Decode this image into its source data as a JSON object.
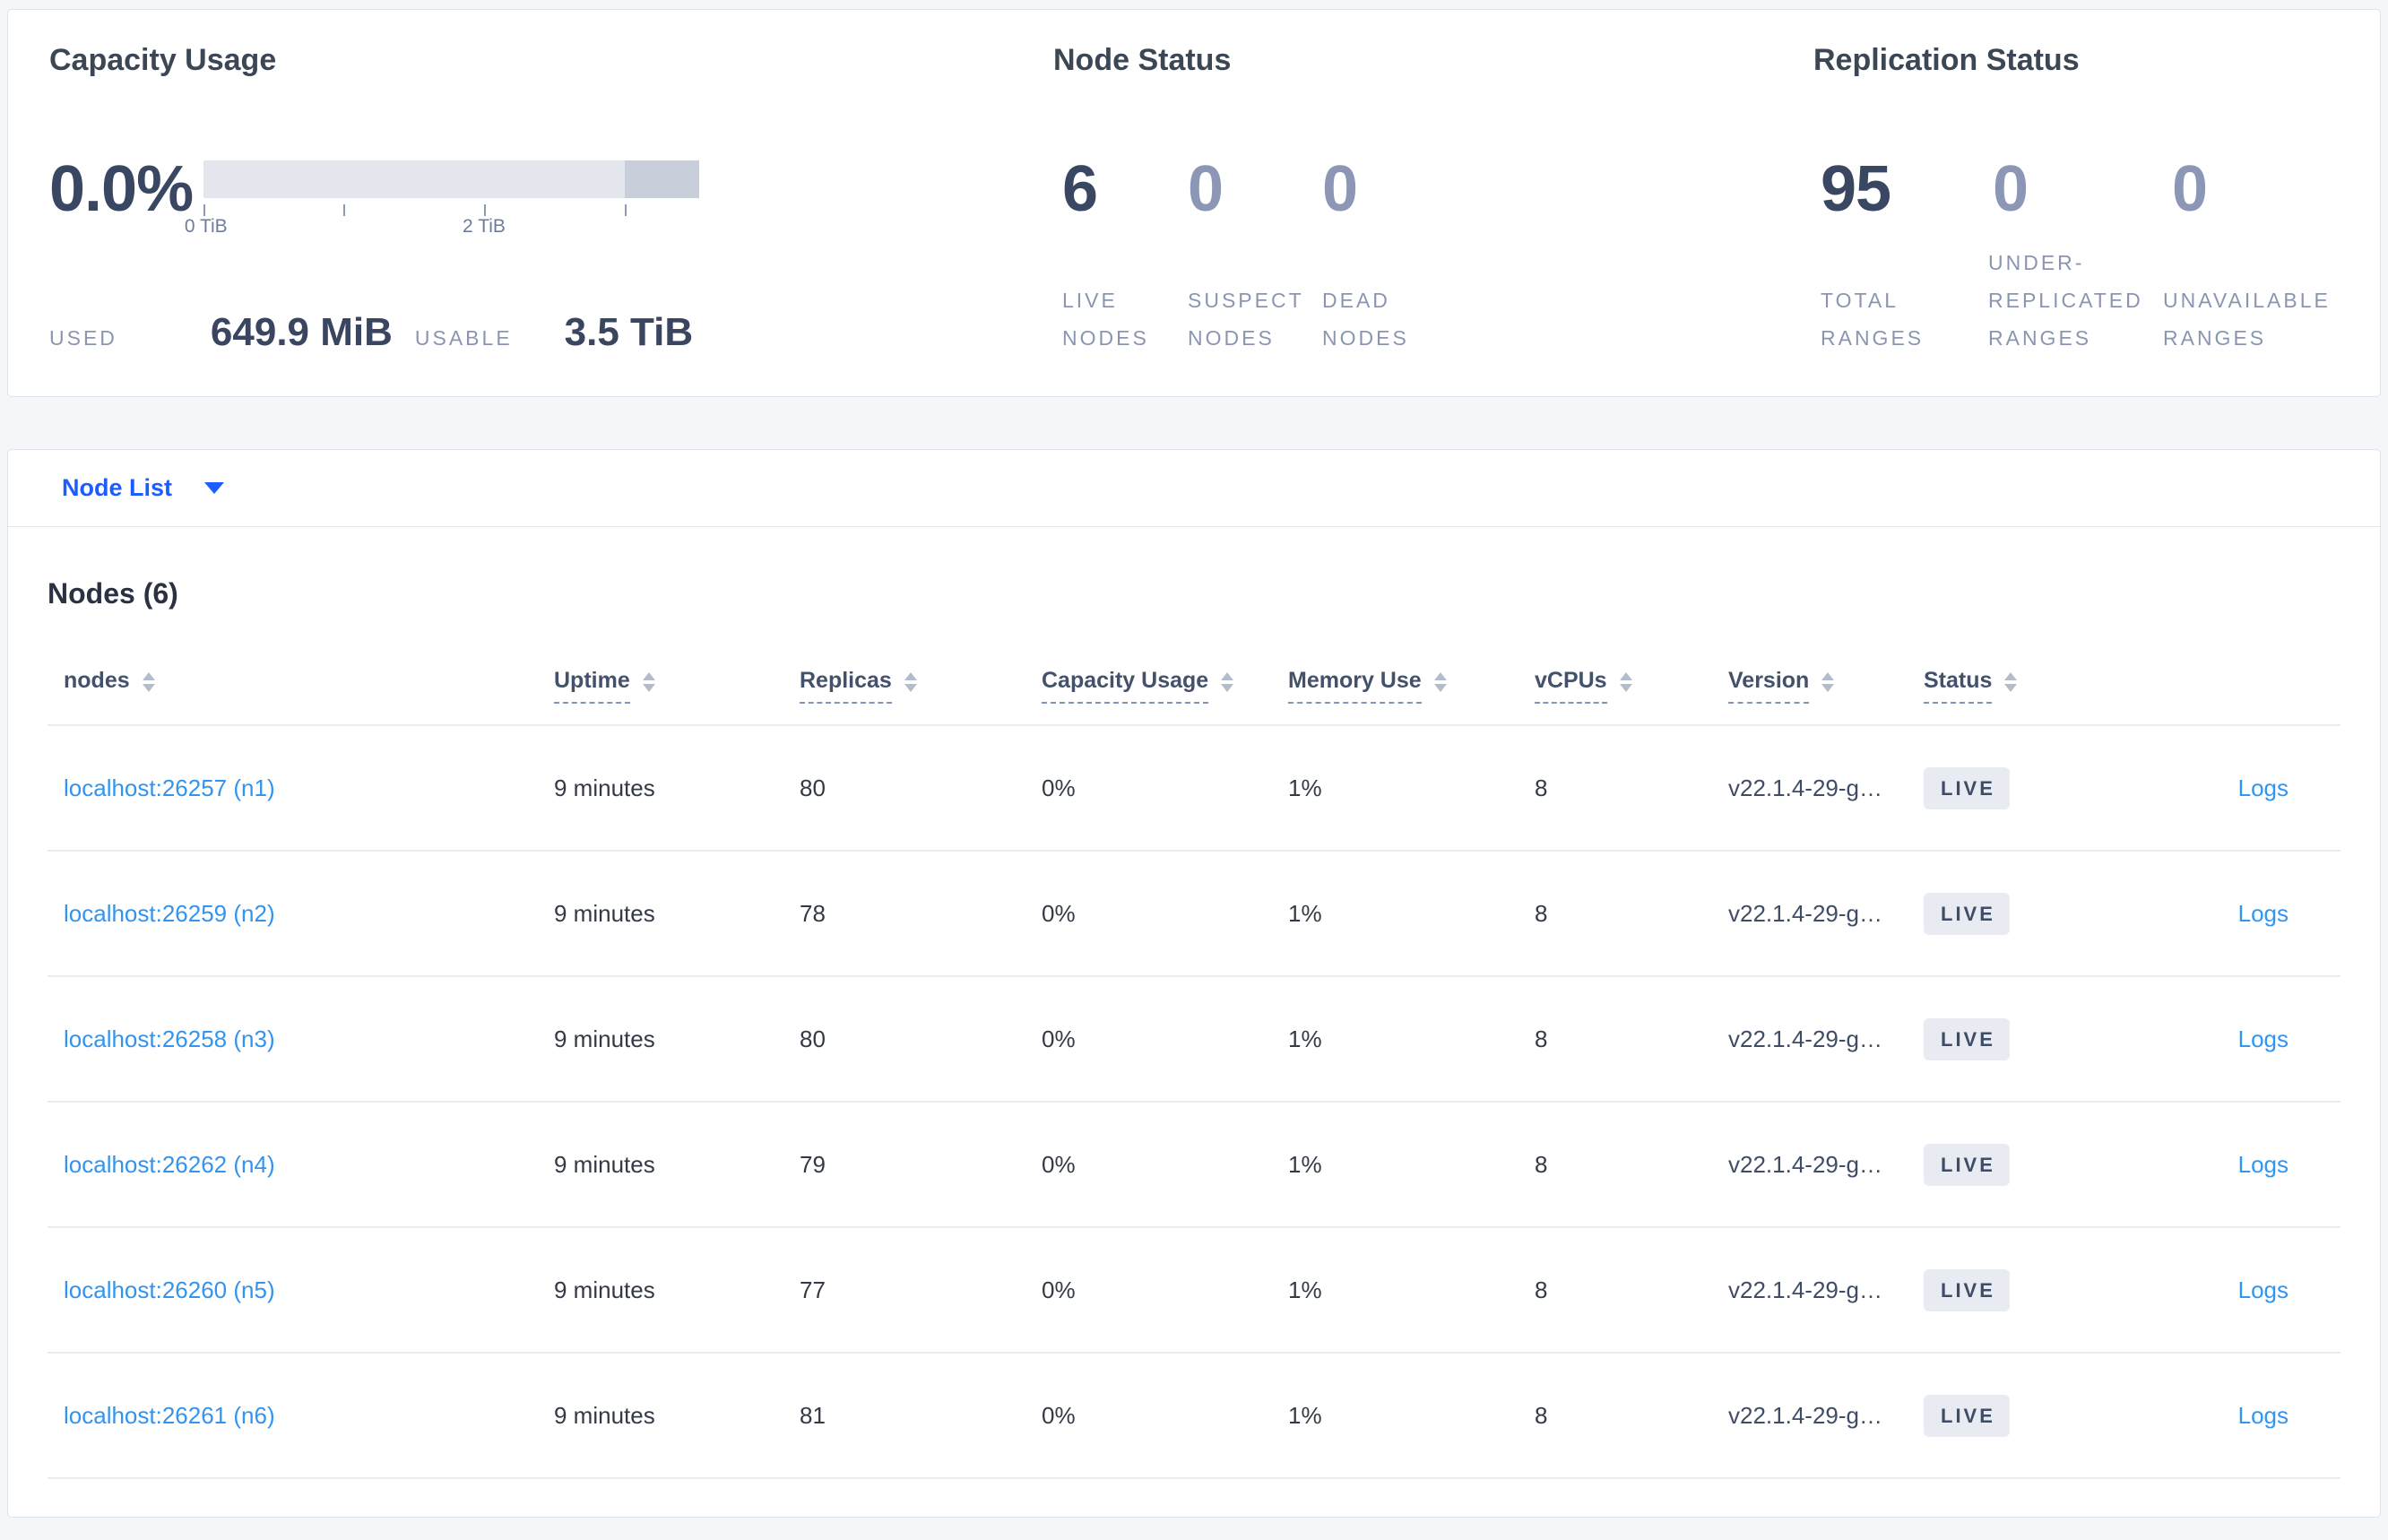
{
  "stats_panel": {
    "capacity": {
      "title": "Capacity Usage",
      "percent": "0.0%",
      "gauge": {
        "dark_segment_from": "85%",
        "tick_positions": [
          "0%",
          "28.3%",
          "56.6%",
          "85%"
        ],
        "tick_labels": [
          {
            "text": "0 TiB",
            "at": "0.5%"
          },
          {
            "text": "2 TiB",
            "at": "56.6%"
          }
        ]
      },
      "used_label": "USED",
      "used_value": "649.9 MiB",
      "usable_label": "USABLE",
      "usable_value": "3.5 TiB"
    },
    "node_status": {
      "title": "Node Status",
      "stats": [
        {
          "value": "6",
          "label": "LIVE NODES"
        },
        {
          "value": "0",
          "label": "SUSPECT NODES"
        },
        {
          "value": "0",
          "label": "DEAD NODES"
        }
      ]
    },
    "replication_status": {
      "title": "Replication Status",
      "stats": [
        {
          "value": "95",
          "label": "TOTAL RANGES"
        },
        {
          "value": "0",
          "label": "UNDER-REPLICATED RANGES"
        },
        {
          "value": "0",
          "label": "UNAVAILABLE RANGES"
        }
      ]
    }
  },
  "view_selector": {
    "label": "Node List"
  },
  "nodes_section": {
    "heading": "Nodes (6)",
    "columns": [
      "nodes",
      "Uptime",
      "Replicas",
      "Capacity Usage",
      "Memory Use",
      "vCPUs",
      "Version",
      "Status"
    ],
    "rows": [
      {
        "node": "localhost:26257 (n1)",
        "uptime": "9 minutes",
        "replicas": "80",
        "capacity": "0%",
        "memory": "1%",
        "vcpus": "8",
        "version": "v22.1.4-29-g…",
        "status": "LIVE",
        "logs": "Logs"
      },
      {
        "node": "localhost:26259 (n2)",
        "uptime": "9 minutes",
        "replicas": "78",
        "capacity": "0%",
        "memory": "1%",
        "vcpus": "8",
        "version": "v22.1.4-29-g…",
        "status": "LIVE",
        "logs": "Logs"
      },
      {
        "node": "localhost:26258 (n3)",
        "uptime": "9 minutes",
        "replicas": "80",
        "capacity": "0%",
        "memory": "1%",
        "vcpus": "8",
        "version": "v22.1.4-29-g…",
        "status": "LIVE",
        "logs": "Logs"
      },
      {
        "node": "localhost:26262 (n4)",
        "uptime": "9 minutes",
        "replicas": "79",
        "capacity": "0%",
        "memory": "1%",
        "vcpus": "8",
        "version": "v22.1.4-29-g…",
        "status": "LIVE",
        "logs": "Logs"
      },
      {
        "node": "localhost:26260 (n5)",
        "uptime": "9 minutes",
        "replicas": "77",
        "capacity": "0%",
        "memory": "1%",
        "vcpus": "8",
        "version": "v22.1.4-29-g…",
        "status": "LIVE",
        "logs": "Logs"
      },
      {
        "node": "localhost:26261 (n6)",
        "uptime": "9 minutes",
        "replicas": "81",
        "capacity": "0%",
        "memory": "1%",
        "vcpus": "8",
        "version": "v22.1.4-29-g…",
        "status": "LIVE",
        "logs": "Logs"
      }
    ]
  },
  "colors": {
    "page_background": "#f4f6fa",
    "accent_blue": "#1d5cff",
    "link_blue": "#3294ee",
    "dark_stat": "#394763",
    "muted_stat": "#8b97b5",
    "badge_background": "#e8ebf2"
  }
}
